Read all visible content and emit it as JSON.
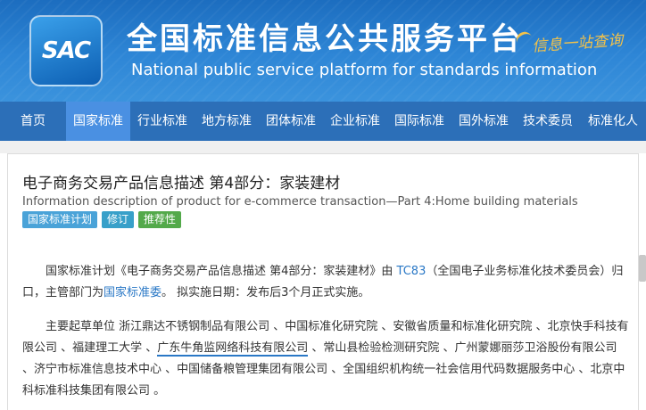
{
  "header": {
    "logo_text": "SAC",
    "title_cn": "全国标准信息公共服务平台",
    "title_en": "National public service platform  for standards information",
    "slogan": "信息一站查询"
  },
  "nav": {
    "items": [
      "首页",
      "国家标准",
      "行业标准",
      "地方标准",
      "团体标准",
      "企业标准",
      "国际标准",
      "国外标准",
      "技术委员",
      "标准化人"
    ],
    "active_index": 1
  },
  "standard": {
    "title": "电子商务交易产品信息描述 第4部分：家装建材",
    "title_en": "Information description of product for e-commerce transaction—Part 4:Home building materials",
    "tags": [
      "国家标准计划",
      "修订",
      "推荐性"
    ]
  },
  "paragraph1": {
    "prefix": "国家标准计划《电子商务交易产品信息描述 第4部分：家装建材》由 ",
    "tc_link": "TC83",
    "middle": "（全国电子业务标准化技术委员会）归口，主管部门为",
    "dept_link": "国家标准委",
    "suffix": "。 拟实施日期：发布后3个月正式实施。"
  },
  "paragraph2": {
    "label": "主要起草单位 ",
    "part1": "浙江鼎达不锈钢制品有限公司 、中国标准化研究院 、安徽省质量和标准化研究院 、北京快手科技有限公司 、福建理工大学 、",
    "highlighted": "广东牛角监网络科技有限公司",
    "part2": " 、常山县检验检测研究院 、广州蒙娜丽莎卫浴股份有限公司 、济宁市标准信息技术中心 、中国储备粮管理集团有限公司 、全国组织机构统一社会信用代码数据服务中心 、北京中科标准科技集团有限公司 。"
  },
  "colors": {
    "banner": "#2e86d6",
    "nav": "#2c6fb8",
    "nav_active": "#4a90e2",
    "link": "#2a78c6",
    "tag_blue": "#4aa3d8",
    "tag_green": "#53a94a"
  }
}
